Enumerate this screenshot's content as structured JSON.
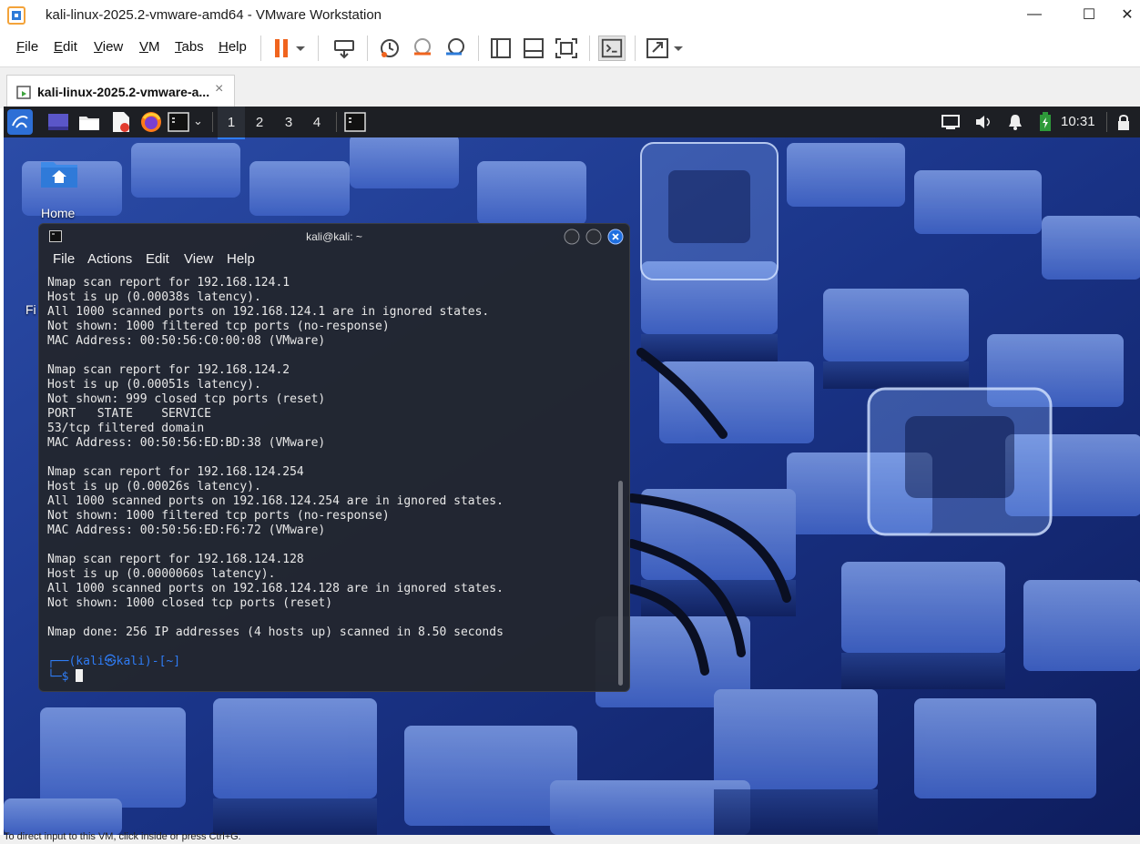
{
  "window": {
    "title": "kali-linux-2025.2-vmware-amd64 - VMware Workstation"
  },
  "menu": [
    "File",
    "Edit",
    "View",
    "VM",
    "Tabs",
    "Help"
  ],
  "tab": {
    "label": "kali-linux-2025.2-vmware-a...",
    "close": "×"
  },
  "panel": {
    "workspaces": [
      "1",
      "2",
      "3",
      "4"
    ],
    "clock": "10:31"
  },
  "desktop": {
    "home_label": "Home",
    "partial_label": "Fi"
  },
  "terminal": {
    "title": "kali@kali: ~",
    "menu": [
      "File",
      "Actions",
      "Edit",
      "View",
      "Help"
    ],
    "lines": [
      "Nmap scan report for 192.168.124.1",
      "Host is up (0.00038s latency).",
      "All 1000 scanned ports on 192.168.124.1 are in ignored states.",
      "Not shown: 1000 filtered tcp ports (no-response)",
      "MAC Address: 00:50:56:C0:00:08 (VMware)",
      "",
      "Nmap scan report for 192.168.124.2",
      "Host is up (0.00051s latency).",
      "Not shown: 999 closed tcp ports (reset)",
      "PORT   STATE    SERVICE",
      "53/tcp filtered domain",
      "MAC Address: 00:50:56:ED:BD:38 (VMware)",
      "",
      "Nmap scan report for 192.168.124.254",
      "Host is up (0.00026s latency).",
      "All 1000 scanned ports on 192.168.124.254 are in ignored states.",
      "Not shown: 1000 filtered tcp ports (no-response)",
      "MAC Address: 00:50:56:ED:F6:72 (VMware)",
      "",
      "Nmap scan report for 192.168.124.128",
      "Host is up (0.0000060s latency).",
      "All 1000 scanned ports on 192.168.124.128 are in ignored states.",
      "Not shown: 1000 closed tcp ports (reset)",
      "",
      "Nmap done: 256 IP addresses (4 hosts up) scanned in 8.50 seconds"
    ],
    "prompt_line1": "┌──(kali㉿kali)-[~]",
    "prompt_line2": "└─$ "
  },
  "status": {
    "text": "To direct input to this VM, click inside or press Ctrl+G."
  },
  "colors": {
    "accent": "#2f7cf5",
    "panel": "#1d1f24",
    "terminal_bg": "#23262d",
    "close_button": "#1f6fe0"
  }
}
